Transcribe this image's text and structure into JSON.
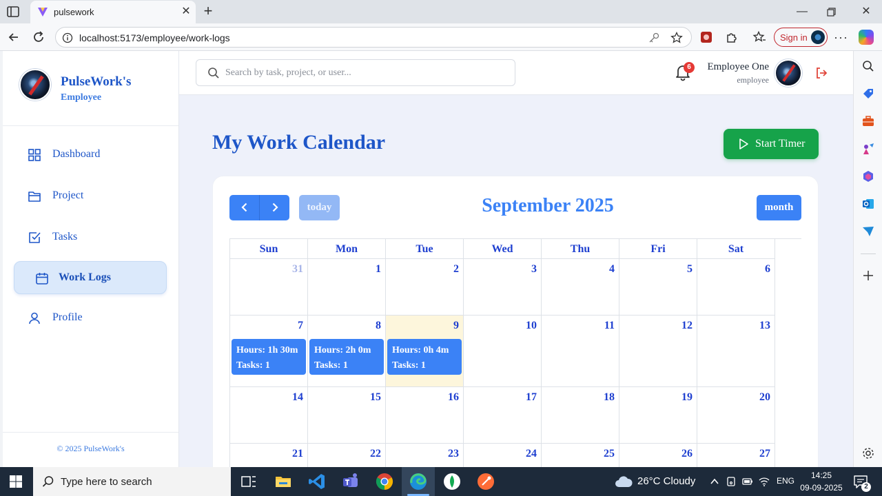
{
  "browser": {
    "tab_title": "pulsework",
    "url": "localhost:5173/employee/work-logs",
    "sign_in_label": "Sign in"
  },
  "brand": {
    "name": "PulseWork's",
    "role": "Employee",
    "copyright": "© 2025 PulseWork's"
  },
  "sidebar": {
    "items": [
      {
        "label": "Dashboard",
        "icon": "grid-icon",
        "active": false
      },
      {
        "label": "Project",
        "icon": "folder-icon",
        "active": false
      },
      {
        "label": "Tasks",
        "icon": "checkbox-icon",
        "active": false
      },
      {
        "label": "Work Logs",
        "icon": "calendar-icon",
        "active": true
      },
      {
        "label": "Profile",
        "icon": "user-icon",
        "active": false
      }
    ]
  },
  "topbar": {
    "search_placeholder": "Search by task, project, or user...",
    "notification_count": "6",
    "user_name": "Employee One",
    "user_role": "employee"
  },
  "page": {
    "title": "My Work Calendar",
    "start_timer_label": "Start Timer"
  },
  "calendar": {
    "title": "September 2025",
    "today_label": "today",
    "month_label": "month",
    "weekdays": [
      "Sun",
      "Mon",
      "Tue",
      "Wed",
      "Thu",
      "Fri",
      "Sat"
    ],
    "weeks": [
      {
        "days": [
          {
            "num": "31",
            "other": true
          },
          {
            "num": "1"
          },
          {
            "num": "2"
          },
          {
            "num": "3"
          },
          {
            "num": "4"
          },
          {
            "num": "5"
          },
          {
            "num": "6"
          }
        ]
      },
      {
        "days": [
          {
            "num": "7",
            "event": {
              "hours": "Hours: 1h 30m",
              "tasks": "Tasks: 1"
            }
          },
          {
            "num": "8",
            "event": {
              "hours": "Hours: 2h 0m",
              "tasks": "Tasks: 1"
            }
          },
          {
            "num": "9",
            "today": true,
            "event": {
              "hours": "Hours: 0h 4m",
              "tasks": "Tasks: 1"
            }
          },
          {
            "num": "10"
          },
          {
            "num": "11"
          },
          {
            "num": "12"
          },
          {
            "num": "13"
          }
        ]
      },
      {
        "days": [
          {
            "num": "14"
          },
          {
            "num": "15"
          },
          {
            "num": "16"
          },
          {
            "num": "17"
          },
          {
            "num": "18"
          },
          {
            "num": "19"
          },
          {
            "num": "20"
          }
        ]
      },
      {
        "days": [
          {
            "num": "21"
          },
          {
            "num": "22"
          },
          {
            "num": "23"
          },
          {
            "num": "24"
          },
          {
            "num": "25"
          },
          {
            "num": "26"
          },
          {
            "num": "27"
          }
        ]
      }
    ]
  },
  "taskbar": {
    "search_text": "Type here to search",
    "weather": "26°C  Cloudy",
    "language": "ENG",
    "time": "14:25",
    "date": "09-09-2025",
    "notification_count": "2"
  },
  "colors": {
    "brand_blue": "#1e56c8",
    "accent_blue": "#3b82f6",
    "timer_green": "#16a34a",
    "today_bg": "#fdf6dc",
    "badge_red": "#e53935"
  }
}
